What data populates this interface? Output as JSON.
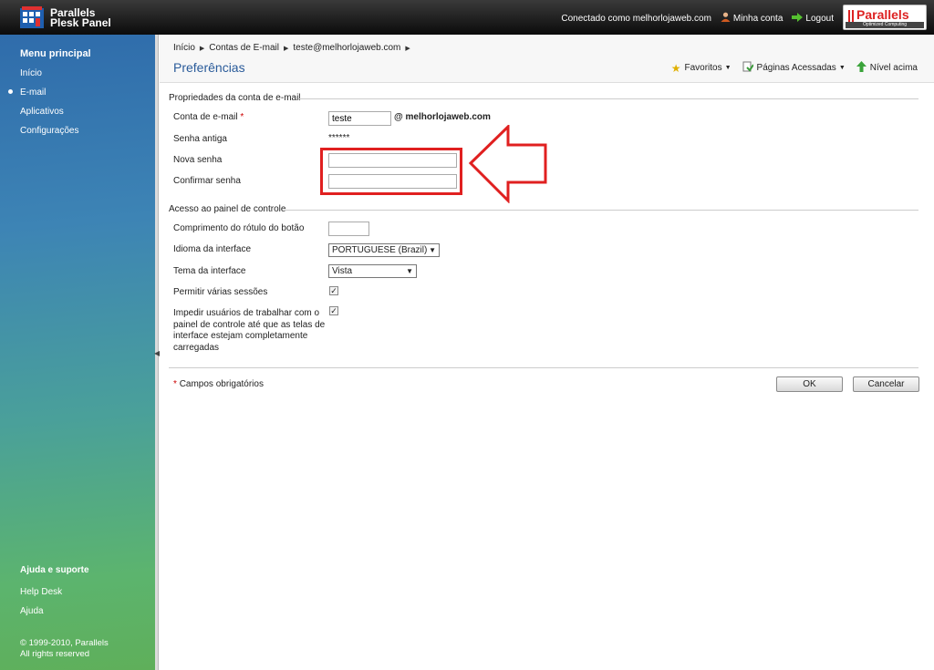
{
  "app": {
    "name_line1": "Parallels",
    "name_line2": "Plesk Panel",
    "logo_word": "Parallels",
    "logo_tagline": "Optimized Computing"
  },
  "topbar": {
    "connected_as": "Conectado como melhorlojaweb.com",
    "my_account": "Minha conta",
    "logout": "Logout"
  },
  "sidebar": {
    "menu_title": "Menu principal",
    "items": [
      {
        "label": "Início"
      },
      {
        "label": "E-mail",
        "active": true
      },
      {
        "label": "Aplicativos"
      },
      {
        "label": "Configurações"
      }
    ],
    "help_title": "Ajuda e suporte",
    "help_items": [
      {
        "label": "Help Desk"
      },
      {
        "label": "Ajuda"
      }
    ],
    "copyright_line1": "© 1999-2010, Parallels",
    "copyright_line2": "All rights reserved"
  },
  "breadcrumb": [
    "Início",
    "Contas de E-mail",
    "teste@melhorlojaweb.com"
  ],
  "page_title": "Preferências",
  "toolbar": {
    "favorites": "Favoritos",
    "visited_pages": "Páginas Acessadas",
    "up_level": "Nível acima"
  },
  "account_section": {
    "legend": "Propriedades da conta de e-mail",
    "email_label": "Conta de e-mail",
    "email_value": "teste",
    "email_domain": "@ melhorlojaweb.com",
    "old_password_label": "Senha antiga",
    "old_password_value": "******",
    "new_password_label": "Nova senha",
    "new_password_value": "",
    "confirm_password_label": "Confirmar senha",
    "confirm_password_value": ""
  },
  "control_section": {
    "legend": "Acesso ao painel de controle",
    "button_label_length_label": "Comprimento do rótulo do botão",
    "button_label_length_value": "",
    "language_label": "Idioma da interface",
    "language_value": "PORTUGUESE (Brazil)",
    "theme_label": "Tema da interface",
    "theme_value": "Vista",
    "multiple_sessions_label": "Permitir várias sessões",
    "multiple_sessions_checked": true,
    "prevent_label_line1": "Impedir usuários de trabalhar com o",
    "prevent_label_line2": "painel de controle até que as telas de",
    "prevent_label_line3": "interface estejam completamente",
    "prevent_label_line4": "carregadas",
    "prevent_checked": true
  },
  "footer": {
    "required_note": "Campos obrigatórios",
    "ok_label": "OK",
    "cancel_label": "Cancelar"
  },
  "colors": {
    "highlight": "#e02020",
    "title_blue": "#2a5b9a"
  }
}
